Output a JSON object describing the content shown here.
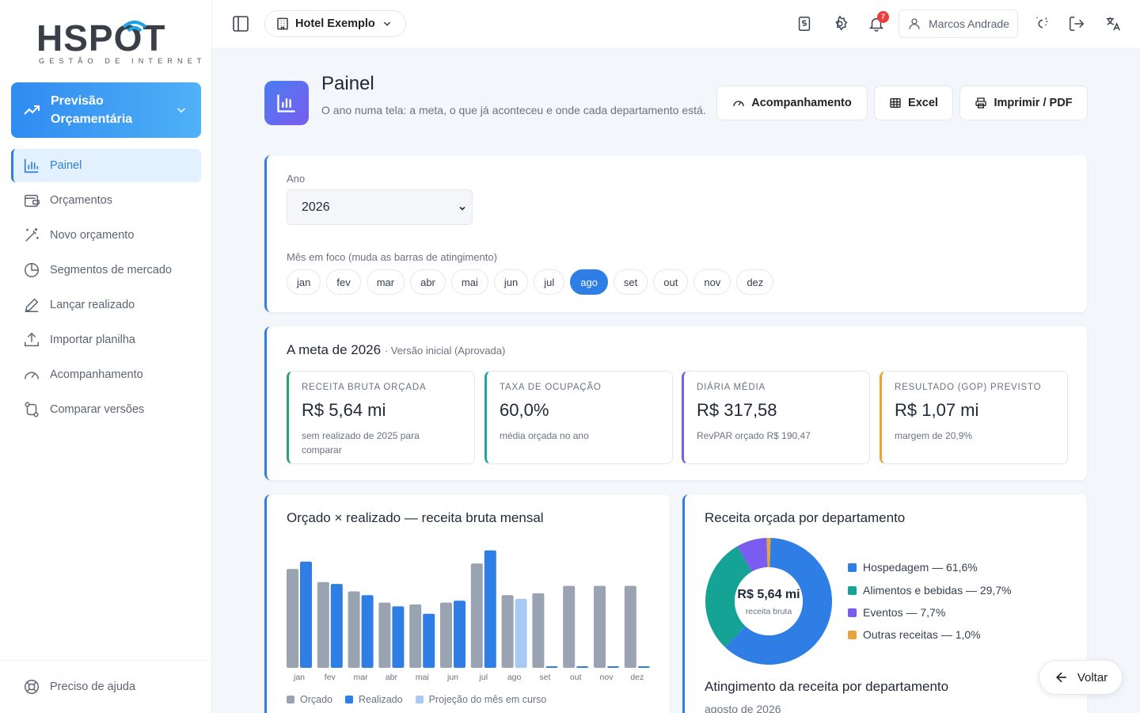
{
  "brand": {
    "logo": "HSPOT",
    "tagline": "GESTÃO DE INTERNET"
  },
  "module": {
    "title": "Previsão Orçamentária"
  },
  "nav": [
    {
      "label": "Painel",
      "icon": "bar-chart-icon",
      "active": true
    },
    {
      "label": "Orçamentos",
      "icon": "wallet-icon"
    },
    {
      "label": "Novo orçamento",
      "icon": "magic-wand-icon"
    },
    {
      "label": "Segmentos de mercado",
      "icon": "pie-chart-icon"
    },
    {
      "label": "Lançar realizado",
      "icon": "pencil-icon"
    },
    {
      "label": "Importar planilha",
      "icon": "upload-icon"
    },
    {
      "label": "Acompanhamento",
      "icon": "gauge-icon"
    },
    {
      "label": "Comparar versões",
      "icon": "compare-icon"
    }
  ],
  "help": {
    "label": "Preciso de ajuda"
  },
  "topbar": {
    "hotel": "Hotel Exemplo",
    "notifications": "7",
    "user": "Marcos Andrade"
  },
  "header": {
    "title": "Painel",
    "description": "O ano numa tela: a meta, o que já aconteceu e onde cada departamento está.",
    "buttons": {
      "tracking": "Acompanhamento",
      "excel": "Excel",
      "print": "Imprimir / PDF"
    }
  },
  "filters": {
    "year_label": "Ano",
    "year": "2026",
    "month_label": "Mês em foco (muda as barras de atingimento)",
    "months": [
      "jan",
      "fev",
      "mar",
      "abr",
      "mai",
      "jun",
      "jul",
      "ago",
      "set",
      "out",
      "nov",
      "dez"
    ],
    "selected_month": "ago"
  },
  "goal": {
    "title": "A meta de 2026",
    "version": "· Versão inicial (Aprovada)",
    "kpis": [
      {
        "label": "RECEITA BRUTA ORÇADA",
        "value": "R$ 5,64 mi",
        "note": "sem realizado de 2025 para comparar",
        "color": "#2aa36b"
      },
      {
        "label": "TAXA DE OCUPAÇÃO",
        "value": "60,0%",
        "note": "média orçada no ano",
        "color": "#1fa89a"
      },
      {
        "label": "DIÁRIA MÉDIA",
        "value": "R$ 317,58",
        "note": "RevPAR orçado R$ 190,47",
        "color": "#7a5cf0"
      },
      {
        "label": "RESULTADO (GOP) PREVISTO",
        "value": "R$ 1,07 mi",
        "note": "margem de 20,9%",
        "color": "#e8a33a"
      }
    ]
  },
  "monthly_chart": {
    "title": "Orçado × realizado — receita bruta mensal",
    "legend": [
      "Orçado",
      "Realizado",
      "Projeção do mês em curso"
    ],
    "colors": {
      "budget": "#9aa3b2",
      "actual": "#2f7ee6",
      "projection": "#a9c9f5"
    }
  },
  "dept_chart": {
    "title": "Receita orçada por departamento",
    "center_value": "R$ 5,64 mi",
    "center_label": "receita bruta"
  },
  "attainment": {
    "title": "Atingimento da receita por departamento",
    "subtitle": "agosto de 2026"
  },
  "voltar": {
    "label": "Voltar"
  },
  "chart_data": [
    {
      "type": "bar",
      "categories": [
        "jan",
        "fev",
        "mar",
        "abr",
        "mai",
        "jun",
        "jul",
        "ago",
        "set",
        "out",
        "nov",
        "dez"
      ],
      "series": [
        {
          "name": "Orçado",
          "values": [
            0.53,
            0.46,
            0.41,
            0.35,
            0.34,
            0.35,
            0.56,
            0.39,
            0.4,
            0.44,
            0.44,
            0.44
          ]
        },
        {
          "name": "Realizado",
          "values": [
            0.57,
            0.45,
            0.39,
            0.33,
            0.29,
            0.36,
            0.63,
            0.37,
            0.005,
            0.005,
            0.005,
            0.005
          ]
        }
      ],
      "ylim": [
        0,
        0.68
      ],
      "grid": false,
      "legend": "bottom"
    },
    {
      "type": "pie",
      "labels": [
        "Hospedagem — 61,6%",
        "Alimentos e bebidas — 29,7%",
        "Eventos — 7,7%",
        "Outras receitas — 1,0%"
      ],
      "values": [
        61.6,
        29.7,
        7.7,
        1.0
      ],
      "colors": [
        "#2f7ee6",
        "#14a395",
        "#7a5cf0",
        "#e8a33a"
      ],
      "legend": "right"
    }
  ]
}
